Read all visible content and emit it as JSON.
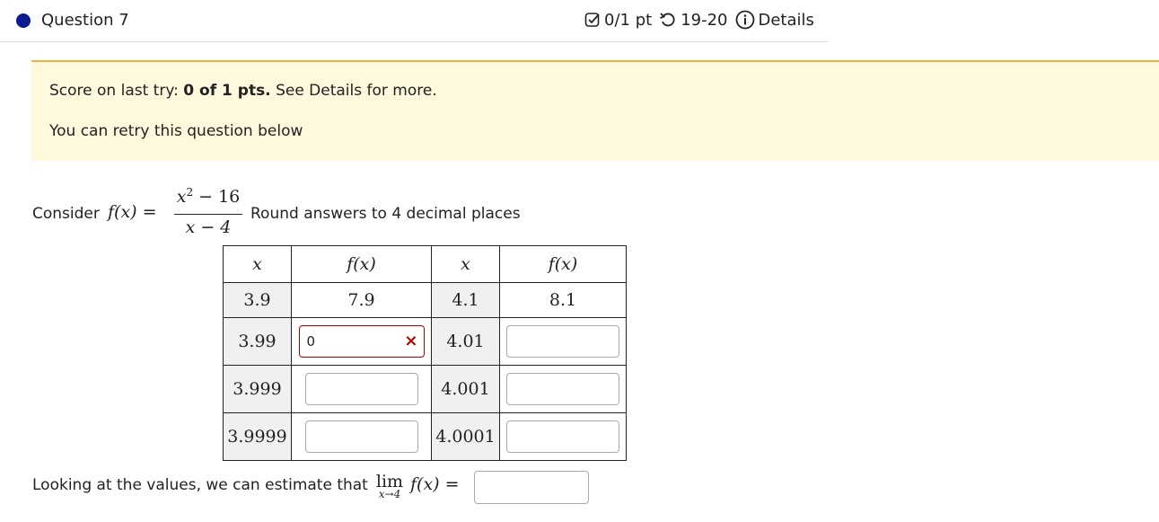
{
  "header": {
    "question_title": "Question 7",
    "points": "0/1 pt",
    "attempts": "19-20",
    "details_label": "Details",
    "status_color": "#0a1c8f"
  },
  "banner": {
    "score_prefix": "Score on last try:",
    "score_value": "0 of 1 pts.",
    "score_suffix": "See Details for more.",
    "retry_text": "You can retry this question below"
  },
  "prompt": {
    "consider": "Consider",
    "func_lhs": "f(x) =",
    "numerator_base": "x",
    "numerator_exp": "2",
    "numerator_rest": " − 16",
    "denominator": "x − 4",
    "rounding_note": "Round answers to 4 decimal places"
  },
  "table": {
    "headers": [
      "x",
      "f(x)",
      "x",
      "f(x)"
    ],
    "rows": [
      {
        "x_left": "3.9",
        "fx_left": "7.9",
        "x_right": "4.1",
        "fx_right": "8.1"
      },
      {
        "x_left": "3.99",
        "fx_left_input": "0",
        "fx_left_status": "incorrect",
        "x_right": "4.01",
        "fx_right_input": ""
      },
      {
        "x_left": "3.999",
        "fx_left_input": "",
        "x_right": "4.001",
        "fx_right_input": ""
      },
      {
        "x_left": "3.9999",
        "fx_left_input": "",
        "x_right": "4.0001",
        "fx_right_input": ""
      }
    ],
    "incorrect_mark": "×"
  },
  "conclusion": {
    "text": "Looking at the values, we can estimate that",
    "lim_word": "lim",
    "lim_sub": "x→4",
    "lim_expr": "f(x) =",
    "answer": ""
  }
}
